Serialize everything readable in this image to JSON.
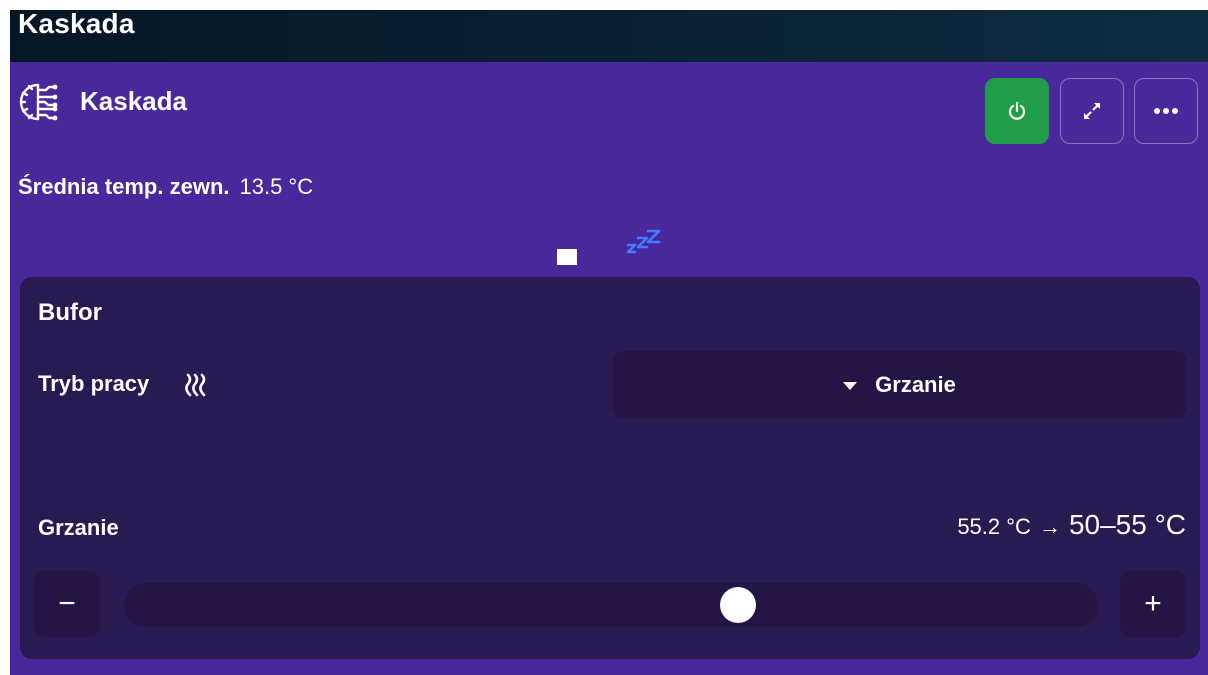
{
  "header": {
    "title": "Kaskada"
  },
  "card": {
    "title": "Kaskada",
    "icon": "processor-circuit-icon",
    "buttons": {
      "power": "power-icon",
      "expand": "expand-icon",
      "more": "more-icon"
    },
    "accent_power_color": "#1f9e47"
  },
  "average_temp": {
    "label": "Średnia temp. zewn.",
    "value": "13.5 °C"
  },
  "status_icons": [
    "stop-square-icon",
    "sleep-zzz-icon"
  ],
  "buffer": {
    "title": "Bufor",
    "mode_label": "Tryb pracy",
    "mode_icon": "heat-waves-icon",
    "mode_value": "Grzanie",
    "heating": {
      "label": "Grzanie",
      "current": "55.2 °C",
      "arrow": "→",
      "range": "50–55 °C",
      "slider_level": 0.63,
      "minus_label": "−",
      "plus_label": "+"
    }
  }
}
